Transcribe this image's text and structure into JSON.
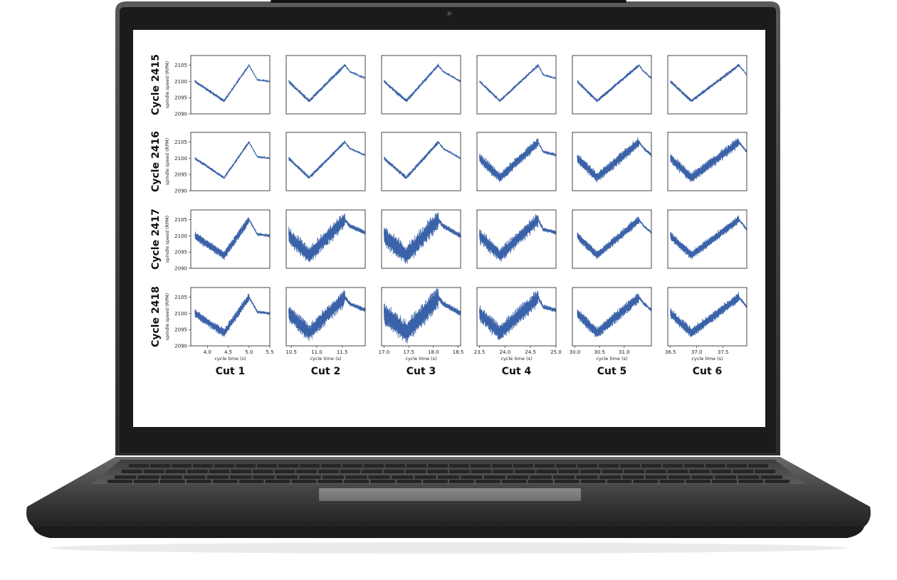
{
  "colors": {
    "series": "#3a62a8",
    "frame": "#333333",
    "bezel": "#1b1b1b",
    "body": "#4a4a4a"
  },
  "icons": [
    "webcam-icon",
    "trackpad-icon",
    "keyboard-icon"
  ],
  "chart_data": {
    "type": "line",
    "rows": [
      "Cycle 2415",
      "Cycle 2416",
      "Cycle 2417",
      "Cycle 2418"
    ],
    "columns": [
      "Cut 1",
      "Cut 2",
      "Cut 3",
      "Cut 4",
      "Cut 5",
      "Cut 6"
    ],
    "ylabel": "spindle speed (RPM)",
    "xlabel": "cycle time (s)",
    "ylim": [
      2090,
      2108
    ],
    "yticks": [
      "2105",
      "2100",
      "2095",
      "2090"
    ],
    "ytick_values": [
      2105,
      2100,
      2095,
      2090
    ],
    "panels_x": [
      {
        "xlim": [
          3.6,
          5.5
        ],
        "ticks": [
          4.0,
          4.5,
          5.0,
          5.5
        ],
        "tick_labels": [
          "4.0",
          "4.5",
          "5.0",
          "5.5"
        ],
        "key_x": [
          3.7,
          4.4,
          5.0,
          5.2,
          5.5
        ],
        "key_y": [
          2100,
          2094,
          2105,
          2100.5,
          2100
        ]
      },
      {
        "xlim": [
          10.4,
          11.95
        ],
        "ticks": [
          10.5,
          11.0,
          11.5
        ],
        "tick_labels": [
          "10.5",
          "11.0",
          "11.5"
        ],
        "key_x": [
          10.45,
          10.85,
          11.55,
          11.65,
          11.95
        ],
        "key_y": [
          2100,
          2094,
          2105,
          2103,
          2101
        ]
      },
      {
        "xlim": [
          16.95,
          18.55
        ],
        "ticks": [
          17.0,
          17.5,
          18.0,
          18.5
        ],
        "tick_labels": [
          "17.0",
          "17.5",
          "18.0",
          "18.5"
        ],
        "key_x": [
          17.0,
          17.45,
          18.1,
          18.2,
          18.55
        ],
        "key_y": [
          2100,
          2094,
          2105,
          2103,
          2100
        ]
      },
      {
        "xlim": [
          23.45,
          25.0
        ],
        "ticks": [
          23.5,
          24.0,
          24.5,
          25.0
        ],
        "tick_labels": [
          "23.5",
          "24.0",
          "24.5",
          "25.0"
        ],
        "key_x": [
          23.5,
          23.9,
          24.65,
          24.75,
          25.0
        ],
        "key_y": [
          2100,
          2094,
          2105,
          2102,
          2101
        ]
      },
      {
        "xlim": [
          29.95,
          31.55
        ],
        "ticks": [
          30.0,
          30.5,
          31.0
        ],
        "tick_labels": [
          "30.0",
          "30.5",
          "31.0"
        ],
        "key_x": [
          30.05,
          30.45,
          31.3,
          31.4,
          31.55
        ],
        "key_y": [
          2100,
          2094,
          2105,
          2103,
          2101
        ]
      },
      {
        "xlim": [
          36.45,
          37.95
        ],
        "ticks": [
          36.5,
          37.0,
          37.5
        ],
        "tick_labels": [
          "36.5",
          "37.0",
          "37.5"
        ],
        "key_x": [
          36.5,
          36.9,
          37.8,
          37.85,
          37.95
        ],
        "key_y": [
          2100,
          2094,
          2105,
          2104,
          2102
        ]
      }
    ],
    "noise_amplitude_rpm": [
      [
        0.4,
        0.5,
        0.5,
        0.4,
        0.5,
        0.5
      ],
      [
        0.4,
        0.5,
        0.6,
        1.8,
        1.8,
        1.8
      ],
      [
        1.5,
        3.0,
        3.5,
        2.5,
        1.5,
        1.5
      ],
      [
        1.5,
        3.0,
        4.0,
        3.0,
        2.0,
        1.8
      ]
    ]
  }
}
